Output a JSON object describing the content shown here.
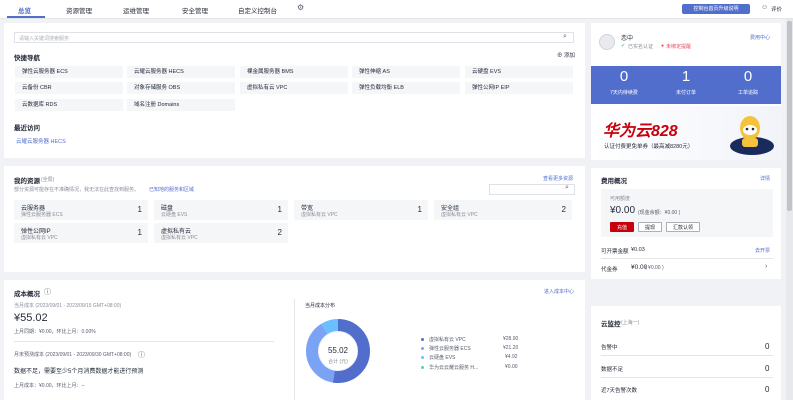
{
  "nav": {
    "tabs": [
      "总览",
      "资源管理",
      "运维管理",
      "安全管理",
      "自定义控制台"
    ],
    "console_btn": "控制台首页升级说明",
    "review": "评价"
  },
  "quick": {
    "search_placeholder": "请输入关键词搜索服务",
    "title": "快捷导航",
    "add": "添加",
    "items": [
      "弹性云服务器 ECS",
      "云耀云服务器 HECS",
      "裸金属服务器 BMS",
      "弹性伸缩 AS",
      "云硬盘 EVS",
      "云备份 CBR",
      "对象存储服务 OBS",
      "虚拟私有云 VPC",
      "弹性负载均衡 ELB",
      "弹性公网IP EIP",
      "云数据库 RDS",
      "域名注册 Domains"
    ],
    "recent_title": "最近访问",
    "recent_item": "云耀云服务器 HECS"
  },
  "resources": {
    "title": "我的资源",
    "scope": "(全局)",
    "more": "查看更多资源",
    "desc": "部分资源可能存在不准确情况，我无法在此查找到服务。",
    "link": "已知地的服务和区域",
    "items": [
      {
        "name": "云服务器",
        "sub": "弹性云服务器 ECS",
        "count": "1"
      },
      {
        "name": "磁盘",
        "sub": "云硬盘 EVS",
        "count": "1"
      },
      {
        "name": "带宽",
        "sub": "虚拟私有云 VPC",
        "count": "1"
      },
      {
        "name": "安全组",
        "sub": "虚拟私有云 VPC",
        "count": "2"
      },
      {
        "name": "弹性公网IP",
        "sub": "虚拟私有云 VPC",
        "count": "1"
      },
      {
        "name": "虚拟私有云",
        "sub": "虚拟私有云 VPC",
        "count": "2"
      }
    ]
  },
  "cost": {
    "title": "成本概况",
    "link": "进入成本中心",
    "current_label": "当月成本 (2023/09/01 - 2023/09/15 GMT+08:00)",
    "current_value": "¥55.02",
    "compare": "上月同期：¥0.00，环比上月：0.00%",
    "forecast_label": "月末预测成本 (2023/09/01 - 2023/09/30 GMT+08:00)",
    "forecast_text": "数据不足，需要至少5个月消费数据才能进行预测",
    "forecast_compare": "上月成本：¥0.00，环比上月：--",
    "dist_title": "当月成本分布",
    "donut_value": "55.02",
    "donut_label": "合计 (元)",
    "breakdown": [
      {
        "name": "虚拟私有云 VPC",
        "value": "¥28.90",
        "color": "#526ecc"
      },
      {
        "name": "弹性云服务器 ECS",
        "value": "¥21.20",
        "color": "#7ba3f5"
      },
      {
        "name": "云硬盘 EVS",
        "value": "¥4.92",
        "color": "#6cbfff"
      },
      {
        "name": "华为云云耀云服务 H...",
        "value": "¥0.00",
        "color": "#50d4ab"
      }
    ]
  },
  "account": {
    "name": "恋中",
    "verified": "已实名认证",
    "badge": "未绑定提醒",
    "user_center": "费用中心",
    "stats": [
      {
        "value": "0",
        "label": "7天内待续费"
      },
      {
        "value": "1",
        "label": "未付订单"
      },
      {
        "value": "0",
        "label": "工单追踪"
      }
    ],
    "banner_brand": "华为云828",
    "banner_text": "认证付费更免单券（最高减8280元）"
  },
  "fee": {
    "title": "费用概况",
    "detail": "详情",
    "available_label": "可用额度",
    "available_value": "¥0.00",
    "available_sub": "(现金余额：¥0.00 )",
    "recharge": "充值",
    "withdraw": "提现",
    "remit": "汇款认领",
    "credit_label": "可开票金额",
    "credit_value": "¥0.03",
    "credit_link": "去开票",
    "voucher_label": "代金券",
    "voucher_value": "¥0.00",
    "voucher_sub": "( ¥0.00 )"
  },
  "monitor": {
    "title": "云监控",
    "scope": "(上海一)",
    "rows": [
      {
        "label": "告警中",
        "value": "0"
      },
      {
        "label": "数据不足",
        "value": "0"
      },
      {
        "label": "近7天告警次数",
        "value": "0"
      }
    ]
  }
}
